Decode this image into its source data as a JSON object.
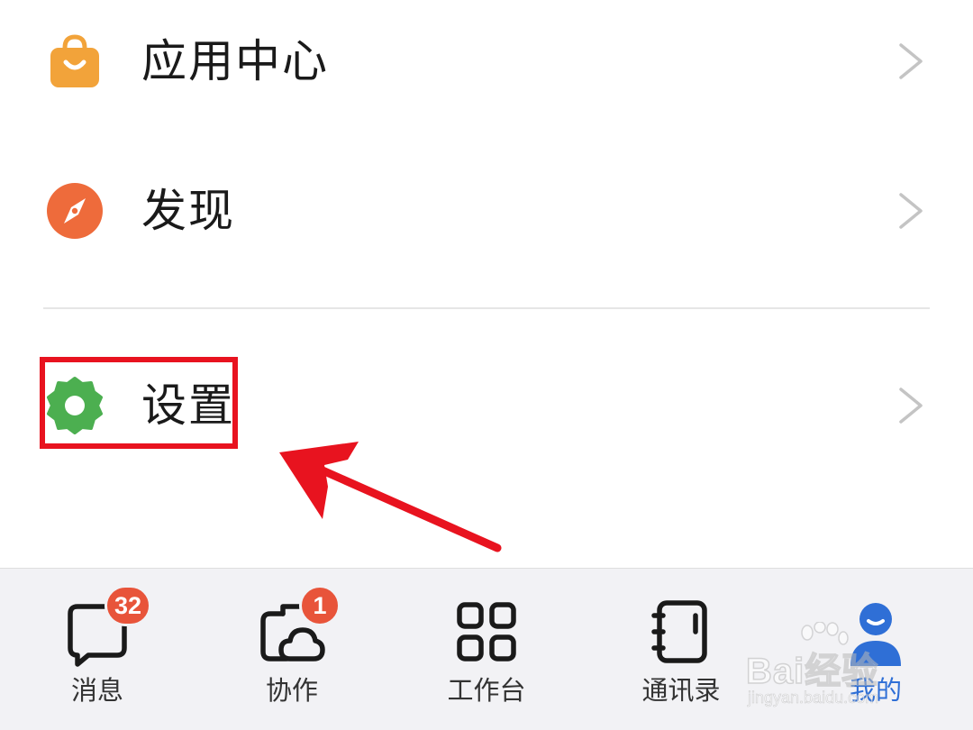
{
  "menu": {
    "items": [
      {
        "label": "应用中心",
        "icon": "shopping-bag-icon",
        "icon_color": "#f2a33a"
      },
      {
        "label": "发现",
        "icon": "compass-icon",
        "icon_color": "#ee6b3b"
      },
      {
        "label": "设置",
        "icon": "gear-icon",
        "icon_color": "#4caf50"
      }
    ]
  },
  "annotation": {
    "highlight_target": "设置",
    "color": "#e8131f"
  },
  "tabbar": {
    "tabs": [
      {
        "label": "消息",
        "icon": "message-icon",
        "badge": "32"
      },
      {
        "label": "协作",
        "icon": "collaboration-icon",
        "badge": "1"
      },
      {
        "label": "工作台",
        "icon": "workbench-grid-icon",
        "badge": ""
      },
      {
        "label": "通讯录",
        "icon": "contacts-book-icon",
        "badge": ""
      },
      {
        "label": "我的",
        "icon": "profile-icon",
        "badge": "",
        "active": true
      }
    ],
    "active_color": "#2f6fd6",
    "badge_color": "#e8543a"
  },
  "watermark": {
    "main": "Bai经验",
    "sub": "jingyan.baidu.com"
  }
}
